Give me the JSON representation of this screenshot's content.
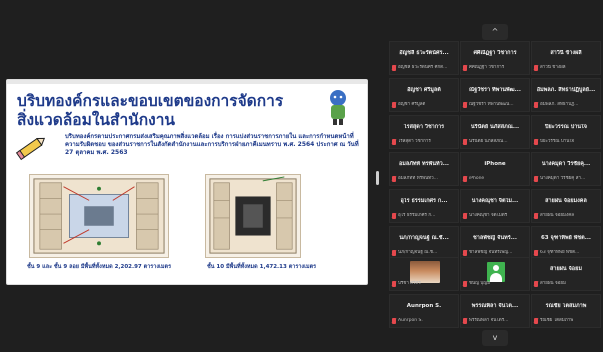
{
  "slide": {
    "title_line1": "บริบทองค์กรและขอบเขตของการจัดการ",
    "title_line2": "สิ่งแวดล้อมในสำนักงาน",
    "description": "บริบทองค์กรตามประกาศกรมส่งเสริมคุณภาพสิ่งแวดล้อม เรื่อง การแบ่งส่วนราชการภายใน และการกำหนดหน้าที่ความรับผิดชอบ ของส่วนราชการในสังกัดสำนักงานและการบริการฝ่ายภาคีเมนทราบ พ.ศ. 2564 ประกาศ ณ วันที่ 27 ตุลาคม พ.ศ. 2563",
    "caption_left": "ชั้น 9 และ ชั้น 9 ลอย มีพื้นที่ทั้งหมด 2,202.97 ตารางเมตร",
    "caption_right": "ชั้น 10 มีพื้นที่ทั้งหมด 1,472.13 ตารางเมตร"
  },
  "gallery": {
    "pager_up": "^",
    "pager_down": "v",
    "tiles": [
      {
        "name": "อัญชลี ธวะรัตน์ศร...",
        "sub": "อัญชลี ธวะรัตน์ศร์ ศักดิ์..."
      },
      {
        "name": "ศศิณัฏฐา วิชาการ",
        "sub": "ศศิณัฏฐา วิชาการ"
      },
      {
        "name": "สาวินี ข้างผลี",
        "sub": "สาวินี ข้างผลี"
      },
      {
        "name": "อัญชา ศรีมูลต์",
        "sub": "อัญชา ศรีมูลต์"
      },
      {
        "name": "ณัฐวัชรา ทิพานพัฒ...",
        "sub": "ณัฐวัชรา ทิพานพัฒน์..."
      },
      {
        "name": "อัมพลภ. สิทธาปฏิบูลย์...",
        "sub": "อัมพลภ. สิทธาปฏิ..."
      },
      {
        "name": "ไรสสุดา วิชาการ",
        "sub": "ไรสสุดา วิชาการ"
      },
      {
        "name": "นรินัตย์ นภัสสภณ...",
        "sub": "นรินัตย์ นภัสสภณ..."
      },
      {
        "name": "ปิยะวรรณ ปานใจ",
        "sub": "ปิยะวรรณ ปานใจ"
      },
      {
        "name": "อมลภัทท์ ทรพันท์ว...",
        "sub": "อมลภัทท์ ทรพันท์ว..."
      },
      {
        "name": "iPhone",
        "sub": "iPhone"
      },
      {
        "name": "นางคมุดา วีรชัยคุ...",
        "sub": "นางคมุดา วีรชัยคุ สำ..."
      },
      {
        "name": "อุไร ธรรมเกศร ก...",
        "sub": "อุไร ธรรมเกศร ก..."
      },
      {
        "name": "นางคณุชา จิตไม...",
        "sub": "นางคณุชา จิตไมตรี"
      },
      {
        "name": "สายฝน จ้อยมงคล",
        "sub": "สายฝน จ้อยมงคล"
      },
      {
        "name": "นภ/กาญจนฐ์ ณ.ชั...",
        "sub": "นภ/กาญจนฐ์ ณ.ชั..."
      },
      {
        "name": "ชาลพัชญ์ จันทร์...",
        "sub": "ชาลพัชญ์ จันทร์เพ็ญ..."
      },
      {
        "name": "63 จุฑาทิพย์ พัชต...",
        "sub": "63 จุฑาทิพย์ พัชต..."
      },
      {
        "name": "",
        "sub": "ปรีชา ศรีศรี"
      },
      {
        "name": "",
        "sub": "ชนัญ บุญมี"
      },
      {
        "name": "สายฝน จ้อยม",
        "sub": "สายฝน จ้อยม"
      },
      {
        "name": "Aunrpon S.",
        "sub": "Aunrpon S."
      },
      {
        "name": "พรรณพิลา จันโต...",
        "sub": "พรรณพิลา จันโตรั..."
      },
      {
        "name": "รณชัย โตสมภาพ",
        "sub": "รณชัย โตสมภาพ"
      }
    ]
  },
  "colors": {
    "background": "#1f1f1f",
    "tile": "#242424",
    "mic_muted": "#e5484d",
    "slide_title": "#1e3a8a"
  }
}
